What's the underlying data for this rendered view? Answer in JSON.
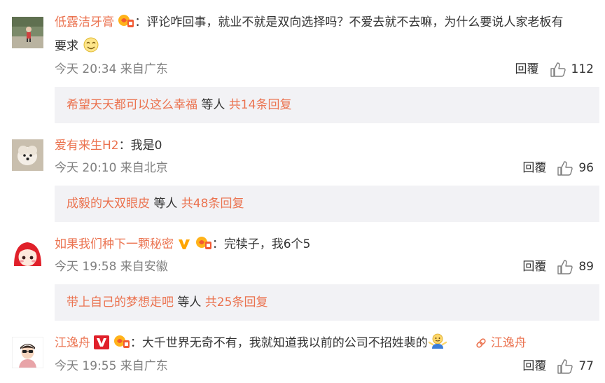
{
  "comments": [
    {
      "user": "低露洁牙膏",
      "text": "评论咋回事，就业不就是双向选择吗？不爱去就不去嘛，为什么要说人家老板有",
      "text_cont": "要求",
      "meta": "今天 20:34 来自广东",
      "reply_label": "回覆",
      "likes": "112",
      "thread": {
        "user": "希望天天都可以这么幸福",
        "mid": " 等人 ",
        "count": "共14条回复"
      }
    },
    {
      "user": "爱有来生H2",
      "text": "我是0",
      "meta": "今天 20:10 来自北京",
      "reply_label": "回覆",
      "likes": "96",
      "thread": {
        "user": "成毅的大双眼皮",
        "mid": " 等人 ",
        "count": "共48条回复"
      }
    },
    {
      "user": "如果我们种下一颗秘密",
      "text": "完犊子，我6个5",
      "meta": "今天 19:58 来自安徽",
      "reply_label": "回覆",
      "likes": "89",
      "thread": {
        "user": "带上自己的梦想走吧",
        "mid": " 等人 ",
        "count": "共25条回复"
      }
    },
    {
      "user": "江逸舟",
      "text": "大千世界无奇不有，我就知道我以前的公司不招姓裴的",
      "link": "江逸舟",
      "meta": "今天 19:55 来自广东",
      "reply_label": "回覆",
      "likes": "77"
    }
  ],
  "colon": "：",
  "colors": {
    "name": "#eb7350",
    "meta": "#808080",
    "reply_bg": "#f2f2f5",
    "vip": "#ff8200"
  }
}
